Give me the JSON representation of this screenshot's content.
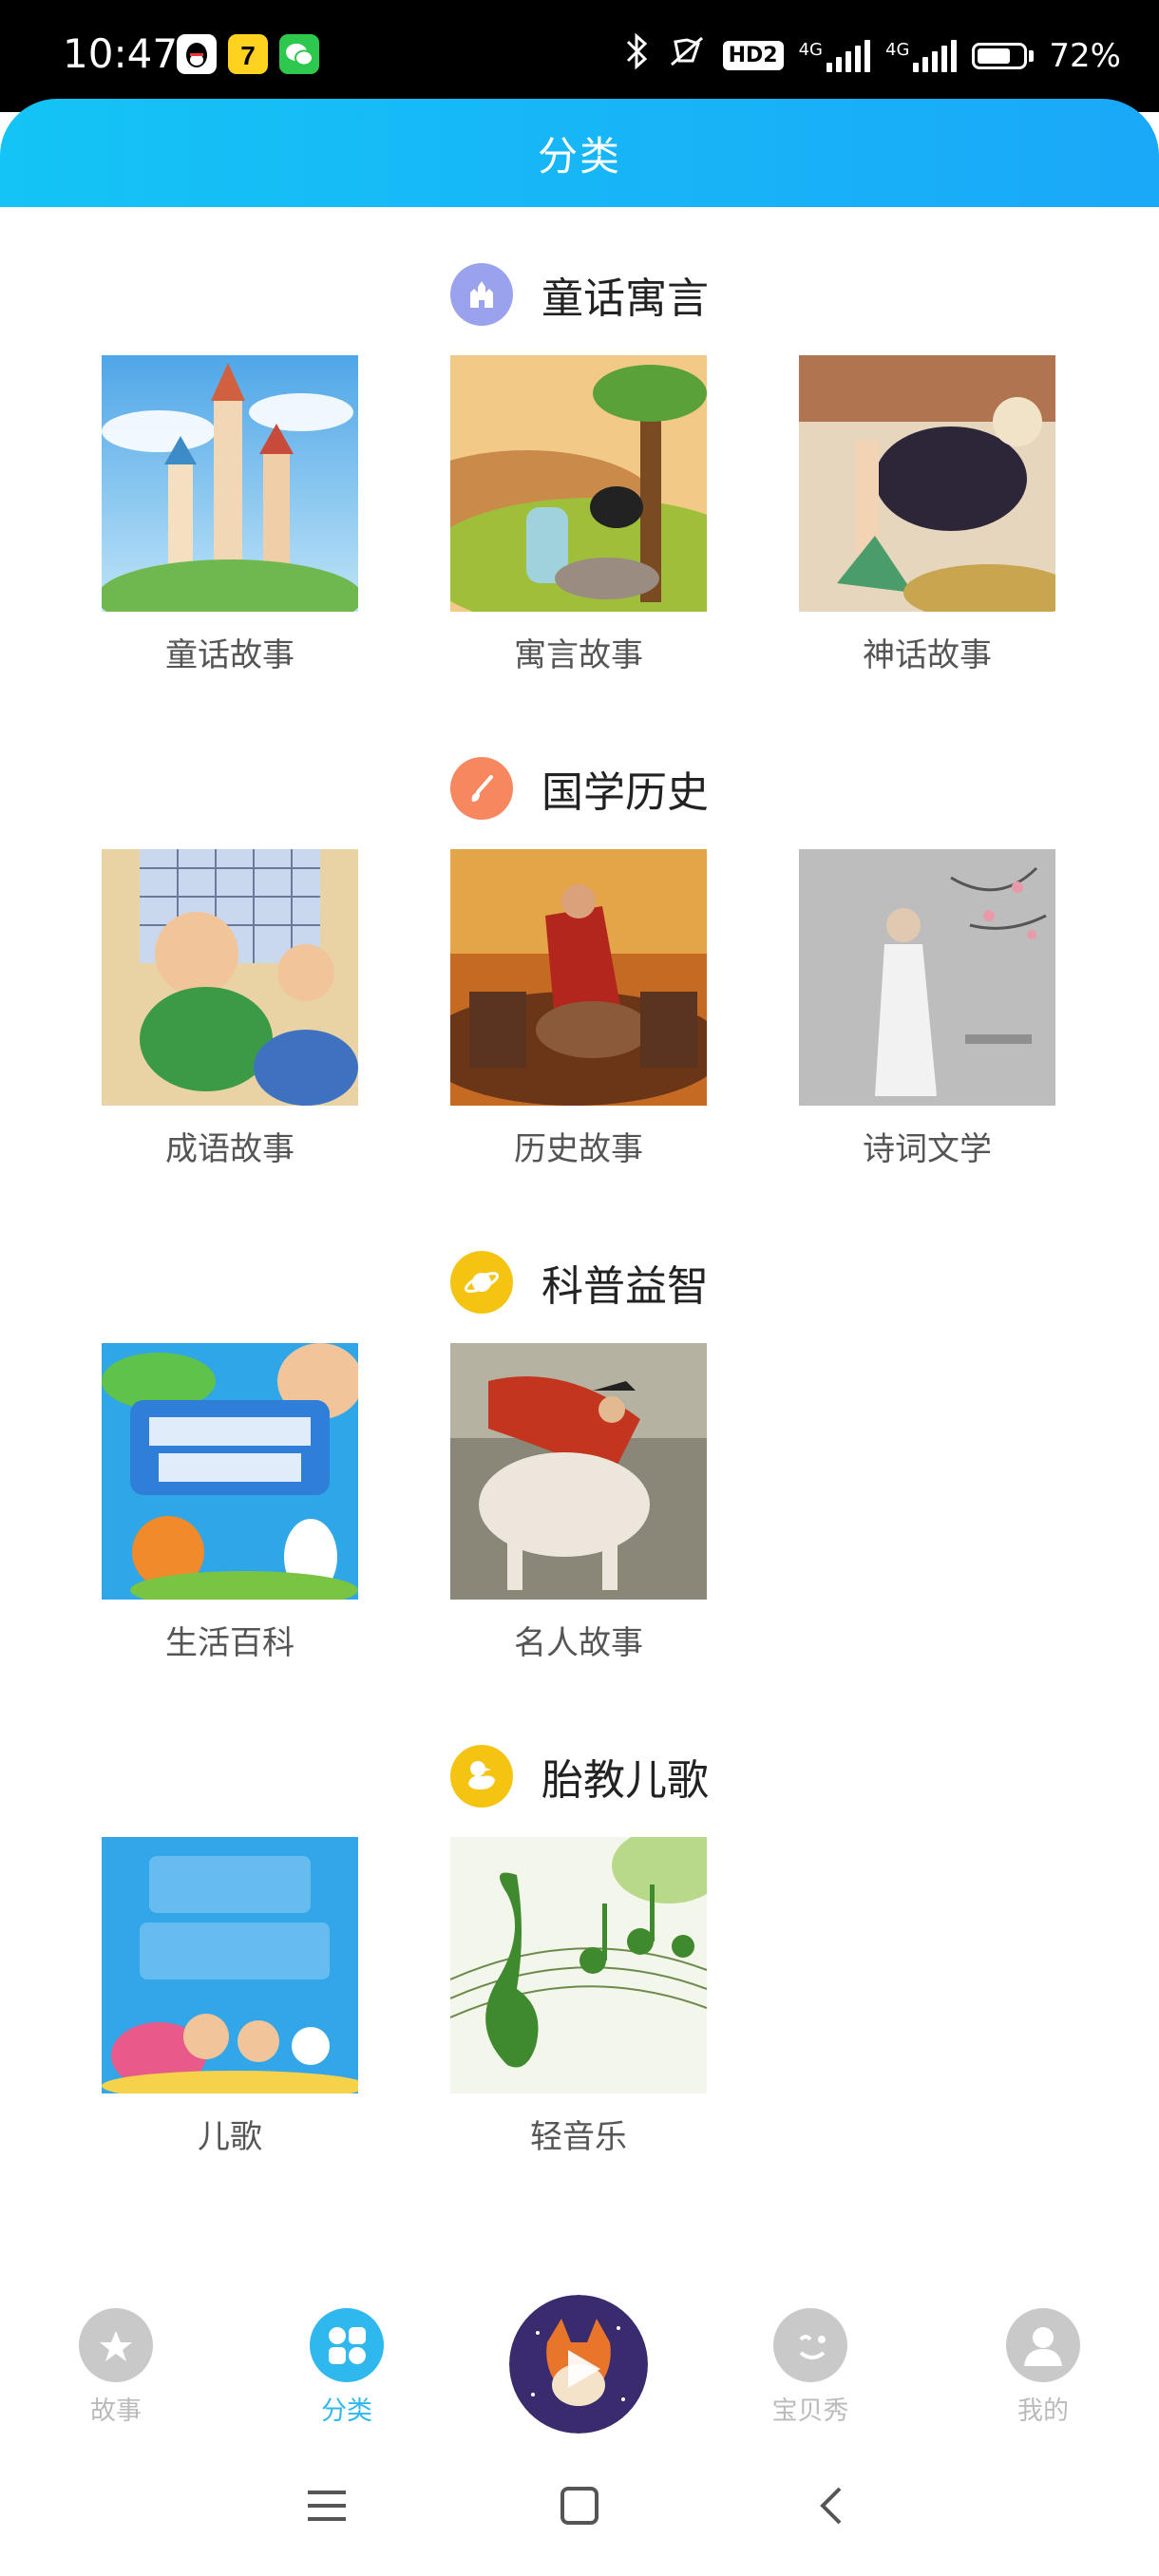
{
  "status_bar": {
    "time": "10:47",
    "network_hd": "HD2",
    "net1": "4G",
    "net2": "4G",
    "battery": "72%",
    "battery_level": 0.72
  },
  "header": {
    "title": "分类"
  },
  "sections": [
    {
      "title": "童话寓言",
      "icon": "castle-icon",
      "color": "#9aa2ee",
      "items": [
        {
          "label": "童话故事"
        },
        {
          "label": "寓言故事"
        },
        {
          "label": "神话故事"
        }
      ]
    },
    {
      "title": "国学历史",
      "icon": "brush-icon",
      "color": "#f7875f",
      "items": [
        {
          "label": "成语故事"
        },
        {
          "label": "历史故事"
        },
        {
          "label": "诗词文学"
        }
      ]
    },
    {
      "title": "科普益智",
      "icon": "planet-icon",
      "color": "#f5c412",
      "items": [
        {
          "label": "生活百科"
        },
        {
          "label": "名人故事"
        }
      ]
    },
    {
      "title": "胎教儿歌",
      "icon": "duck-icon",
      "color": "#f5c412",
      "items": [
        {
          "label": "儿歌"
        },
        {
          "label": "轻音乐"
        }
      ]
    }
  ],
  "bottom_nav": {
    "items": [
      {
        "label": "故事",
        "icon": "planet-star-icon",
        "active": false
      },
      {
        "label": "分类",
        "icon": "grid-icon",
        "active": true
      },
      {
        "label": "宝贝秀",
        "icon": "wink-face-icon",
        "active": false
      },
      {
        "label": "我的",
        "icon": "user-icon",
        "active": false
      }
    ],
    "center": {
      "icon": "play-icon"
    }
  },
  "colors": {
    "accent": "#2fb8ee",
    "inactive": "#bbbbbb"
  }
}
